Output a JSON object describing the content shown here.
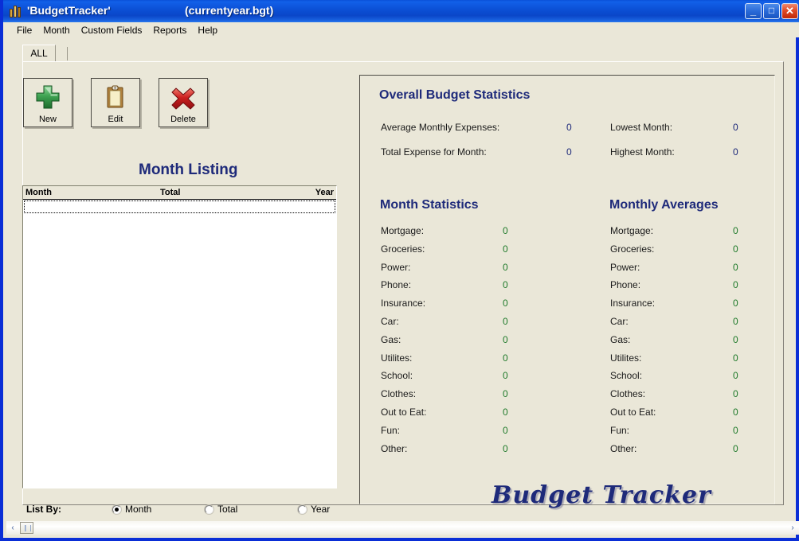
{
  "window": {
    "title": "'BudgetTracker'",
    "file": "(currentyear.bgt)",
    "icon": "chart-bars-icon",
    "buttons": {
      "minimize": "_",
      "maximize": "□",
      "close": "✕"
    }
  },
  "menu": {
    "items": [
      {
        "label": "File"
      },
      {
        "label": "Month"
      },
      {
        "label": "Custom Fields"
      },
      {
        "label": "Reports"
      },
      {
        "label": "Help"
      }
    ]
  },
  "tabs": [
    {
      "label": "ALL",
      "selected": true
    }
  ],
  "toolbar": {
    "new_label": "New",
    "edit_label": "Edit",
    "delete_label": "Delete"
  },
  "month_listing": {
    "heading": "Month Listing",
    "columns": {
      "month": "Month",
      "total": "Total",
      "year": "Year"
    },
    "rows": []
  },
  "list_by": {
    "label": "List By:",
    "options": [
      {
        "label": "Month",
        "selected": true
      },
      {
        "label": "Total",
        "selected": false
      },
      {
        "label": "Year",
        "selected": false
      }
    ]
  },
  "overall": {
    "heading": "Overall Budget Statistics",
    "rows": [
      {
        "label": "Average Monthly Expenses:",
        "value": "0"
      },
      {
        "label": "Total Expense for Month:",
        "value": "0"
      },
      {
        "label": "Lowest Month:",
        "value": "0"
      },
      {
        "label": "Highest Month:",
        "value": "0"
      }
    ]
  },
  "month_statistics": {
    "heading": "Month Statistics",
    "rows": [
      {
        "label": "Mortgage:",
        "value": "0"
      },
      {
        "label": "Groceries:",
        "value": "0"
      },
      {
        "label": "Power:",
        "value": "0"
      },
      {
        "label": "Phone:",
        "value": "0"
      },
      {
        "label": "Insurance:",
        "value": "0"
      },
      {
        "label": "Car:",
        "value": "0"
      },
      {
        "label": "Gas:",
        "value": "0"
      },
      {
        "label": "Utilites:",
        "value": "0"
      },
      {
        "label": "School:",
        "value": "0"
      },
      {
        "label": "Clothes:",
        "value": "0"
      },
      {
        "label": "Out to Eat:",
        "value": "0"
      },
      {
        "label": "Fun:",
        "value": "0"
      },
      {
        "label": "Other:",
        "value": "0"
      }
    ]
  },
  "monthly_averages": {
    "heading": "Monthly Averages",
    "rows": [
      {
        "label": "Mortgage:",
        "value": "0"
      },
      {
        "label": "Groceries:",
        "value": "0"
      },
      {
        "label": "Power:",
        "value": "0"
      },
      {
        "label": "Phone:",
        "value": "0"
      },
      {
        "label": "Insurance:",
        "value": "0"
      },
      {
        "label": "Car:",
        "value": "0"
      },
      {
        "label": "Gas:",
        "value": "0"
      },
      {
        "label": "Utilites:",
        "value": "0"
      },
      {
        "label": "School:",
        "value": "0"
      },
      {
        "label": "Clothes:",
        "value": "0"
      },
      {
        "label": "Out to Eat:",
        "value": "0"
      },
      {
        "label": "Fun:",
        "value": "0"
      },
      {
        "label": "Other:",
        "value": "0"
      }
    ]
  },
  "logo": {
    "text": "Budget Tracker"
  },
  "scrollbar": {
    "left_arrow": "‹",
    "right_arrow": "›"
  },
  "colors": {
    "form_background": "#EAE7D8",
    "title_blue": "#0A4FD4",
    "heading_navy": "#1E2A7A",
    "value_green": "#1F7A2A",
    "value_navy": "#1E2A7A",
    "close_red": "#E04A28"
  }
}
